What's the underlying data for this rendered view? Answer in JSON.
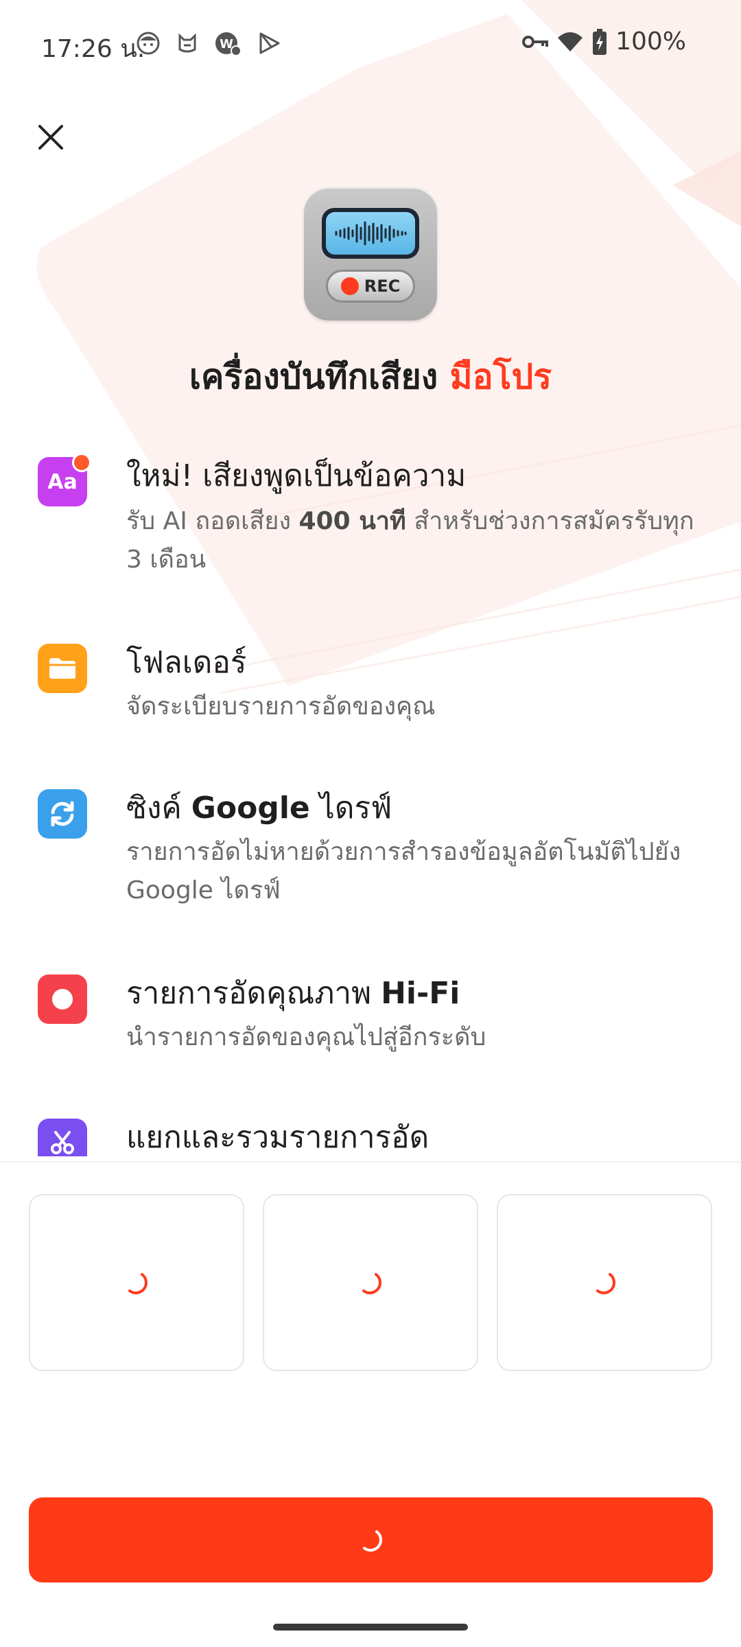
{
  "status_bar": {
    "time": "17:26 น.",
    "battery": "100%",
    "left_icons": [
      "face-icon",
      "cat-icon",
      "badge-app-icon",
      "play-store-icon"
    ],
    "right_icons": [
      "vpn-key-icon",
      "wifi-icon",
      "battery-charging-icon"
    ]
  },
  "header": {
    "close_icon": "close-icon",
    "app_icon_label": "REC"
  },
  "title": {
    "main": "เครื่องบันทึกเสียง",
    "accent": "มือโปร"
  },
  "features": [
    {
      "title": "ใหม่! เสียงพูดเป็นข้อความ",
      "desc_prefix": "รับ AI ถอดเสียง ",
      "desc_bold": "400 นาที",
      "desc_suffix": " สำหรับช่วงการสมัครรับทุก 3 เดือน",
      "icon_text": "Aa",
      "icon": "text-icon",
      "color": "#c640f0",
      "has_badge": true
    },
    {
      "title": "โฟลเดอร์",
      "desc": "จัดระเบียบรายการอัดของคุณ",
      "icon": "folder-icon",
      "color": "#ffa21a"
    },
    {
      "title_prefix": "ซิงค์ ",
      "title_bold": "Google",
      "title_suffix": " ไดรฟ์",
      "desc": "รายการอัดไม่หายด้วยการสำรองข้อมูลอัตโนมัติไปยัง Google ไดรฟ์",
      "icon": "sync-icon",
      "color": "#3aa0ec"
    },
    {
      "title_prefix": "รายการอัดคุณภาพ ",
      "title_bold": "Hi-Fi",
      "desc": "นำรายการอัดของคุณไปสู่อีกระดับ",
      "icon": "record-icon",
      "color": "#f5414b"
    },
    {
      "title": "แยกและรวมรายการอัด",
      "icon": "scissors-icon",
      "color": "#7a4ef0"
    }
  ],
  "plans": {
    "count": 3,
    "state": "loading"
  },
  "cta": {
    "state": "loading"
  },
  "colors": {
    "accent": "#ff3b1f",
    "cta": "#ff3a16",
    "spinner": "#ff3b1f"
  }
}
